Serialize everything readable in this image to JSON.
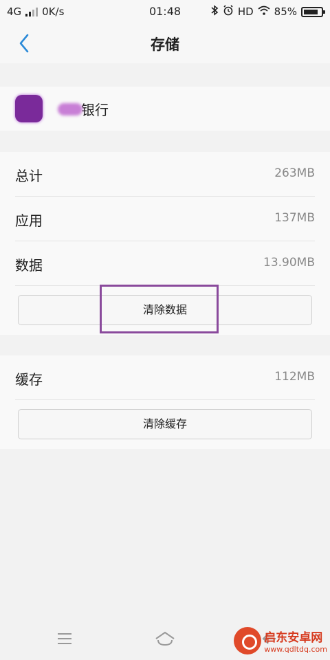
{
  "status_bar": {
    "network": "4G",
    "speed": "0K/s",
    "time": "01:48",
    "hd": "HD",
    "battery_percent": "85%",
    "battery_level": 0.85,
    "icons": [
      "signal-icon",
      "bluetooth-icon",
      "alarm-icon",
      "wifi-icon",
      "battery-icon"
    ]
  },
  "header": {
    "back_icon": "chevron-left-icon",
    "title": "存储"
  },
  "app": {
    "name": "银行",
    "icon": "app-icon"
  },
  "storage": {
    "rows": [
      {
        "label": "总计",
        "value": "263MB"
      },
      {
        "label": "应用",
        "value": "137MB"
      },
      {
        "label": "数据",
        "value": "13.90MB"
      }
    ],
    "clear_data_label": "清除数据"
  },
  "cache": {
    "label": "缓存",
    "value": "112MB",
    "clear_cache_label": "清除缓存"
  },
  "nav": {
    "icons": [
      "menu-icon",
      "home-icon",
      "back-icon"
    ]
  },
  "watermark": {
    "name": "启东安卓网",
    "url": "www.qdltdq.com"
  },
  "colors": {
    "accent": "#2b8ad8",
    "highlight": "#8a4a9c",
    "background": "#f2f2f2"
  }
}
